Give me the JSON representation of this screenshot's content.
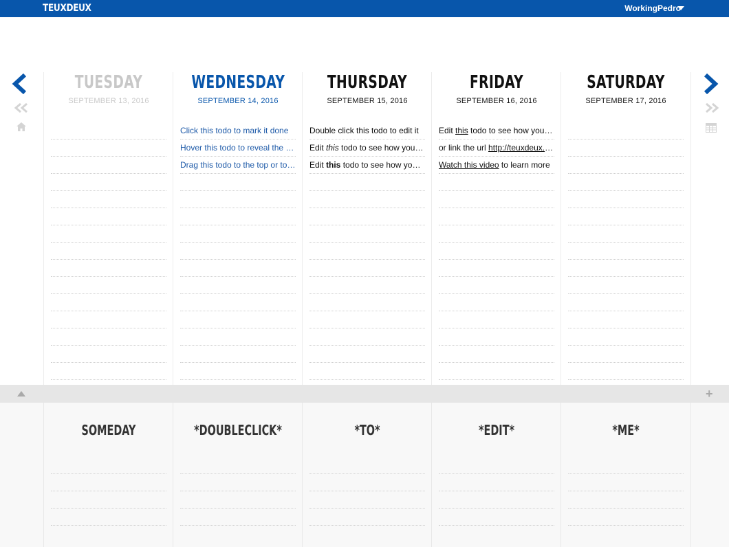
{
  "app": {
    "logo": "TEUXDEUX",
    "user": "WorkingPedro"
  },
  "nav": {
    "prev_icon": "chevron-left-icon",
    "next_icon": "chevron-right-icon",
    "fast_back_icon": "double-chevron-left-icon",
    "fast_forward_icon": "double-chevron-right-icon",
    "home_icon": "home-icon",
    "calendar_icon": "calendar-icon",
    "collapse_icon": "triangle-up-icon",
    "add_icon": "plus-icon"
  },
  "colors": {
    "brand": "#0856ab",
    "past": "#c8c8c8",
    "today": "#0856ab",
    "text": "#111111"
  },
  "days": [
    {
      "name": "TUESDAY",
      "date": "SEPTEMBER 13, 2016",
      "state": "past",
      "todos": []
    },
    {
      "name": "WEDNESDAY",
      "date": "SEPTEMBER 14, 2016",
      "state": "today",
      "todos": [
        "Click this todo to mark it done",
        "Hover this todo to reveal the menu",
        "Drag this todo to the top or to another day"
      ]
    },
    {
      "name": "THURSDAY",
      "date": "SEPTEMBER 15, 2016",
      "state": "future",
      "todos": [
        {
          "parts": [
            "Double click this todo to edit it"
          ]
        },
        {
          "parts": [
            "Edit ",
            "this",
            " todo to see how you can use markdown"
          ]
        },
        {
          "parts": [
            "Edit ",
            "this",
            " todo to see how you can use markdown"
          ]
        }
      ]
    },
    {
      "name": "FRIDAY",
      "date": "SEPTEMBER 16, 2016",
      "state": "future",
      "todos": [
        {
          "parts": [
            "Edit ",
            "this",
            " todo to see how you can add links"
          ]
        },
        {
          "parts": [
            "or link the url ",
            "http://teuxdeux.com"
          ]
        },
        {
          "parts": [
            "Watch this video",
            " to learn more"
          ]
        }
      ]
    },
    {
      "name": "SATURDAY",
      "date": "SEPTEMBER 17, 2016",
      "state": "future",
      "todos": []
    }
  ],
  "someday": [
    {
      "name": "SOMEDAY"
    },
    {
      "name": "*DOUBLECLICK*"
    },
    {
      "name": "*TO*"
    },
    {
      "name": "*EDIT*"
    },
    {
      "name": "*ME*"
    }
  ]
}
